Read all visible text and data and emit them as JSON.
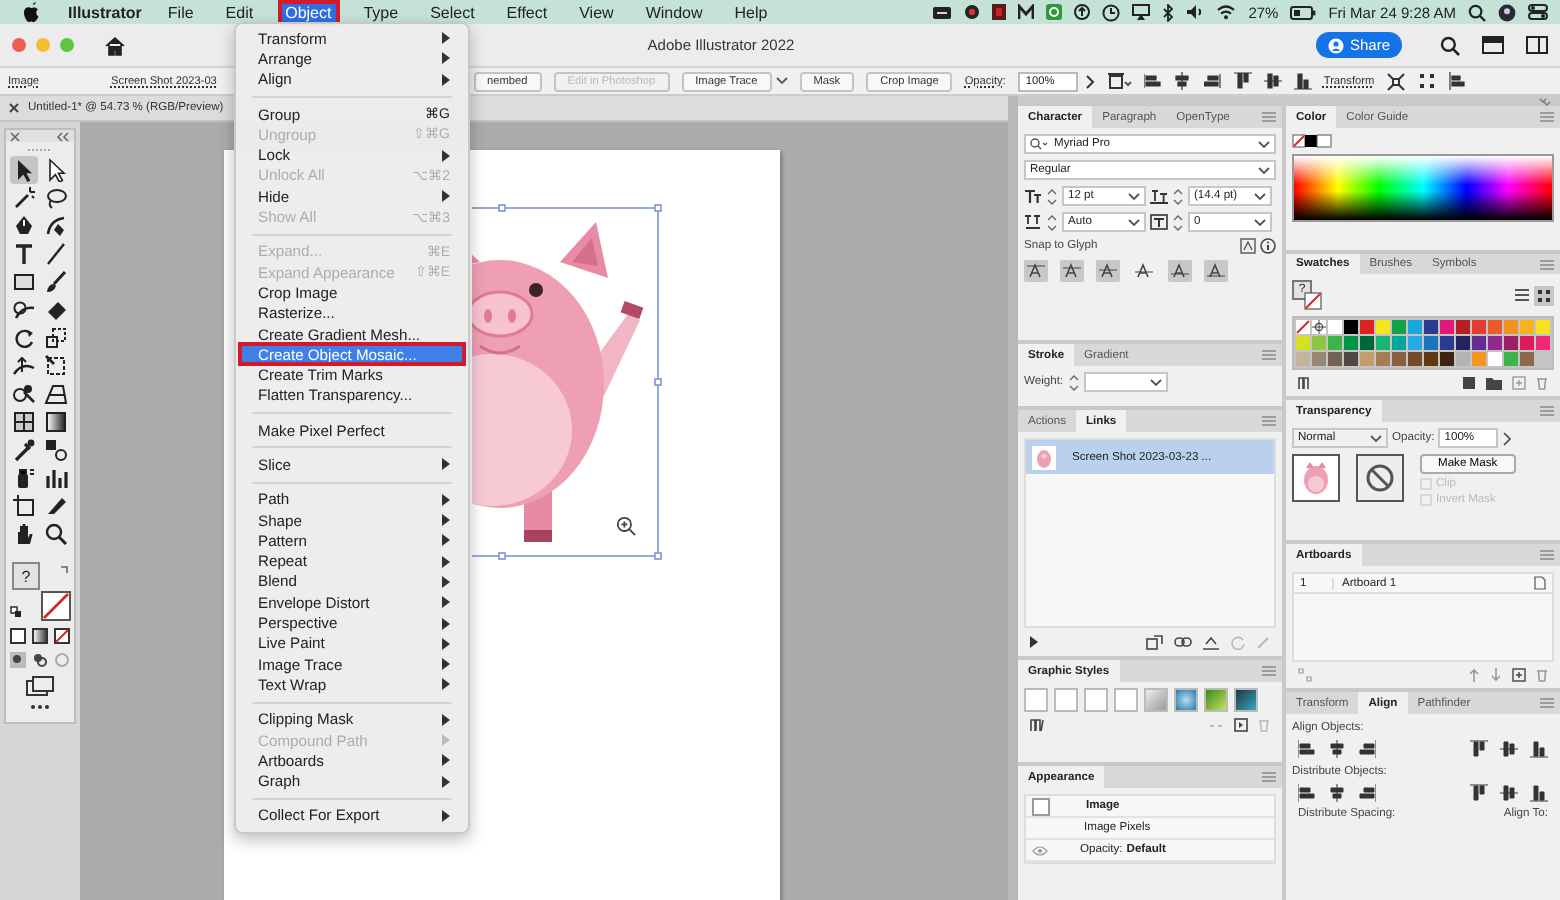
{
  "menubar": {
    "app": "Illustrator",
    "menus": [
      {
        "label": "File",
        "selected": false
      },
      {
        "label": "Edit",
        "selected": false
      },
      {
        "label": "Object",
        "selected": true
      },
      {
        "label": "Type",
        "selected": false
      },
      {
        "label": "Select",
        "selected": false
      },
      {
        "label": "Effect",
        "selected": false
      },
      {
        "label": "View",
        "selected": false
      },
      {
        "label": "Window",
        "selected": false
      },
      {
        "label": "Help",
        "selected": false
      }
    ],
    "battery": "27%",
    "clock": "Fri Mar 24  9:28 AM"
  },
  "window": {
    "title": "Adobe Illustrator 2022",
    "share": "Share"
  },
  "control_bar": {
    "items": [
      {
        "kind": "link",
        "label": "Image"
      },
      {
        "kind": "link",
        "label": "Screen Shot 2023-03"
      },
      {
        "kind": "button",
        "label": "nembed",
        "disabled": false
      },
      {
        "kind": "button",
        "label": "Edit in Photoshop",
        "disabled": true
      },
      {
        "kind": "dropdown",
        "label": "Image Trace"
      },
      {
        "kind": "button",
        "label": "Mask",
        "disabled": false
      },
      {
        "kind": "button",
        "label": "Crop Image",
        "disabled": false
      },
      {
        "kind": "link",
        "label": "Opacity:"
      },
      {
        "kind": "field",
        "label": "100%"
      },
      {
        "kind": "link",
        "label": "Transform"
      }
    ]
  },
  "doc_tab": {
    "title": "Untitled-1* @ 54.73 % (RGB/Preview)"
  },
  "tools": [
    {
      "kind": "selection",
      "selected": true
    },
    {
      "kind": "direct-selection",
      "selected": false
    },
    {
      "kind": "magic-wand",
      "selected": false
    },
    {
      "kind": "lasso",
      "selected": false
    },
    {
      "kind": "pen",
      "selected": false
    },
    {
      "kind": "curvature",
      "selected": false
    },
    {
      "kind": "type",
      "selected": false
    },
    {
      "kind": "line",
      "selected": false
    },
    {
      "kind": "rectangle",
      "selected": false
    },
    {
      "kind": "paintbrush",
      "selected": false
    },
    {
      "kind": "shaper",
      "selected": false
    },
    {
      "kind": "eraser",
      "selected": false
    },
    {
      "kind": "rotate",
      "selected": false
    },
    {
      "kind": "scale",
      "selected": false
    },
    {
      "kind": "width",
      "selected": false
    },
    {
      "kind": "free-transform",
      "selected": false
    },
    {
      "kind": "shape-builder",
      "selected": false
    },
    {
      "kind": "perspective",
      "selected": false
    },
    {
      "kind": "mesh",
      "selected": false
    },
    {
      "kind": "gradient",
      "selected": false
    },
    {
      "kind": "eyedropper",
      "selected": false
    },
    {
      "kind": "blend",
      "selected": false
    },
    {
      "kind": "symbol-sprayer",
      "selected": false
    },
    {
      "kind": "column-graph",
      "selected": false
    },
    {
      "kind": "artboard",
      "selected": false
    },
    {
      "kind": "slice",
      "selected": false
    },
    {
      "kind": "hand",
      "selected": false
    },
    {
      "kind": "zoom",
      "selected": false
    }
  ],
  "fill_stroke": {
    "fill_label": "?"
  },
  "object_menu": {
    "groups": [
      {
        "items": [
          {
            "label": "Transform",
            "submenu": true,
            "disabled": false,
            "selected": false
          },
          {
            "label": "Arrange",
            "submenu": true,
            "disabled": false,
            "selected": false
          },
          {
            "label": "Align",
            "submenu": true,
            "disabled": false,
            "selected": false
          }
        ]
      },
      {
        "items": [
          {
            "label": "Group",
            "shortcut": "⌘G",
            "submenu": false,
            "disabled": false,
            "selected": false
          },
          {
            "label": "Ungroup",
            "shortcut": "⇧⌘G",
            "submenu": false,
            "disabled": true,
            "selected": false
          },
          {
            "label": "Lock",
            "submenu": true,
            "disabled": false,
            "selected": false
          },
          {
            "label": "Unlock All",
            "shortcut": "⌥⌘2",
            "submenu": false,
            "disabled": true,
            "selected": false
          },
          {
            "label": "Hide",
            "submenu": true,
            "disabled": false,
            "selected": false
          },
          {
            "label": "Show All",
            "shortcut": "⌥⌘3",
            "submenu": false,
            "disabled": true,
            "selected": false
          }
        ]
      },
      {
        "items": [
          {
            "label": "Expand...",
            "shortcut": "⌘E",
            "submenu": false,
            "disabled": true,
            "selected": false
          },
          {
            "label": "Expand Appearance",
            "shortcut": "⇧⌘E",
            "submenu": false,
            "disabled": true,
            "selected": false
          },
          {
            "label": "Crop Image",
            "submenu": false,
            "disabled": false,
            "selected": false
          },
          {
            "label": "Rasterize...",
            "submenu": false,
            "disabled": false,
            "selected": false
          },
          {
            "label": "Create Gradient Mesh...",
            "submenu": false,
            "disabled": false,
            "selected": false
          },
          {
            "label": "Create Object Mosaic...",
            "submenu": false,
            "disabled": false,
            "selected": true
          },
          {
            "label": "Create Trim Marks",
            "submenu": false,
            "disabled": false,
            "selected": false
          },
          {
            "label": "Flatten Transparency...",
            "submenu": false,
            "disabled": false,
            "selected": false
          }
        ]
      },
      {
        "items": [
          {
            "label": "Make Pixel Perfect",
            "submenu": false,
            "disabled": false,
            "selected": false
          }
        ]
      },
      {
        "items": [
          {
            "label": "Slice",
            "submenu": true,
            "disabled": false,
            "selected": false
          }
        ]
      },
      {
        "items": [
          {
            "label": "Path",
            "submenu": true,
            "disabled": false,
            "selected": false
          },
          {
            "label": "Shape",
            "submenu": true,
            "disabled": false,
            "selected": false
          },
          {
            "label": "Pattern",
            "submenu": true,
            "disabled": false,
            "selected": false
          },
          {
            "label": "Repeat",
            "submenu": true,
            "disabled": false,
            "selected": false
          },
          {
            "label": "Blend",
            "submenu": true,
            "disabled": false,
            "selected": false
          },
          {
            "label": "Envelope Distort",
            "submenu": true,
            "disabled": false,
            "selected": false
          },
          {
            "label": "Perspective",
            "submenu": true,
            "disabled": false,
            "selected": false
          },
          {
            "label": "Live Paint",
            "submenu": true,
            "disabled": false,
            "selected": false
          },
          {
            "label": "Image Trace",
            "submenu": true,
            "disabled": false,
            "selected": false
          },
          {
            "label": "Text Wrap",
            "submenu": true,
            "disabled": false,
            "selected": false
          }
        ]
      },
      {
        "items": [
          {
            "label": "Clipping Mask",
            "submenu": true,
            "disabled": false,
            "selected": false
          },
          {
            "label": "Compound Path",
            "submenu": true,
            "disabled": true,
            "selected": false
          },
          {
            "label": "Artboards",
            "submenu": true,
            "disabled": false,
            "selected": false
          },
          {
            "label": "Graph",
            "submenu": true,
            "disabled": false,
            "selected": false
          }
        ]
      },
      {
        "items": [
          {
            "label": "Collect For Export",
            "submenu": true,
            "disabled": false,
            "selected": false
          }
        ]
      }
    ]
  },
  "character_panel": {
    "tabs": [
      {
        "label": "Character",
        "selected": true
      },
      {
        "label": "Paragraph",
        "selected": false
      },
      {
        "label": "OpenType",
        "selected": false
      }
    ],
    "font": "Myriad Pro",
    "style": "Regular",
    "size": "12 pt",
    "leading": "(14.4 pt)",
    "kerning": "Auto",
    "tracking": "0",
    "snap_label": "Snap to Glyph"
  },
  "stroke_panel": {
    "tabs": [
      {
        "label": "Stroke",
        "selected": true
      },
      {
        "label": "Gradient",
        "selected": false
      }
    ],
    "weight_label": "Weight:"
  },
  "links_panel": {
    "tabs": [
      {
        "label": "Actions",
        "selected": false
      },
      {
        "label": "Links",
        "selected": true
      }
    ],
    "links": [
      {
        "name": "Screen Shot 2023-03-23 ...",
        "selected": true
      }
    ]
  },
  "graphic_styles_panel": {
    "tabs": [
      {
        "label": "Graphic Styles",
        "selected": true
      }
    ]
  },
  "appearance_panel": {
    "tabs": [
      {
        "label": "Appearance",
        "selected": true
      }
    ],
    "rows": [
      {
        "kind": "title",
        "label": "Image"
      },
      {
        "kind": "plain",
        "label": "Image Pixels"
      },
      {
        "kind": "attribute",
        "label": "Opacity:",
        "value": "Default"
      }
    ]
  },
  "color_panel": {
    "tabs": [
      {
        "label": "Color",
        "selected": true
      },
      {
        "label": "Color Guide",
        "selected": false
      }
    ]
  },
  "swatches_panel": {
    "tabs": [
      {
        "label": "Swatches",
        "selected": true
      },
      {
        "label": "Brushes",
        "selected": false
      },
      {
        "label": "Symbols",
        "selected": false
      }
    ],
    "fill_label": "?",
    "rows": [
      {
        "swatches": [
          {
            "color": "#ffffff"
          },
          {
            "color": "#000000"
          },
          {
            "color": "#d9251c"
          },
          {
            "color": "#f6e71c"
          },
          {
            "color": "#14a24a"
          },
          {
            "color": "#1aa5db"
          },
          {
            "color": "#2b3990"
          },
          {
            "color": "#e2187b"
          },
          {
            "color": "#b52025"
          },
          {
            "color": "#e53d2f"
          },
          {
            "color": "#ea5d2b"
          },
          {
            "color": "#f29024"
          },
          {
            "color": "#f7b21f"
          },
          {
            "color": "#f9e021"
          }
        ]
      },
      {
        "swatches": [
          {
            "color": "#d7df23"
          },
          {
            "color": "#8dc63f"
          },
          {
            "color": "#39b54a"
          },
          {
            "color": "#009444"
          },
          {
            "color": "#006838"
          },
          {
            "color": "#1bb573"
          },
          {
            "color": "#00a79d"
          },
          {
            "color": "#27aae1"
          },
          {
            "color": "#1c75bc"
          },
          {
            "color": "#2b3990"
          },
          {
            "color": "#262262"
          },
          {
            "color": "#662d91"
          },
          {
            "color": "#92278f"
          },
          {
            "color": "#9e1f63"
          },
          {
            "color": "#da1c5c"
          },
          {
            "color": "#ee2a7b"
          }
        ]
      },
      {
        "swatches": [
          {
            "color": "#c2b59b"
          },
          {
            "color": "#998675"
          },
          {
            "color": "#736357"
          },
          {
            "color": "#534741"
          },
          {
            "color": "#c69c6d"
          },
          {
            "color": "#a77c50"
          },
          {
            "color": "#8b5e3c"
          },
          {
            "color": "#754c28"
          },
          {
            "color": "#603913"
          },
          {
            "color": "#3c2415"
          },
          {
            "color": "#b3b3b3"
          },
          {
            "color": "#f7941d"
          },
          {
            "color": "#ffffff"
          },
          {
            "color": "#39b54a"
          },
          {
            "color": "#8b6a4a"
          }
        ]
      }
    ]
  },
  "transparency_panel": {
    "tabs": [
      {
        "label": "Transparency",
        "selected": true
      }
    ],
    "mode": "Normal",
    "opacity_label": "Opacity:",
    "opacity": "100%",
    "make_mask": "Make Mask",
    "options": [
      {
        "label": "Clip",
        "checked": false,
        "disabled": true
      },
      {
        "label": "Invert Mask",
        "checked": false,
        "disabled": true
      }
    ]
  },
  "artboards_panel": {
    "tabs": [
      {
        "label": "Artboards",
        "selected": true
      }
    ],
    "artboards": [
      {
        "number": "1",
        "name": "Artboard 1",
        "selected": false
      }
    ]
  },
  "align_panel": {
    "tabs": [
      {
        "label": "Transform",
        "selected": false
      },
      {
        "label": "Align",
        "selected": true
      },
      {
        "label": "Pathfinder",
        "selected": false
      }
    ],
    "sections": [
      {
        "label": "Align Objects:"
      },
      {
        "label": "Distribute Objects:"
      }
    ],
    "spacing_label": "Distribute Spacing:",
    "align_to_label": "Align To:"
  }
}
